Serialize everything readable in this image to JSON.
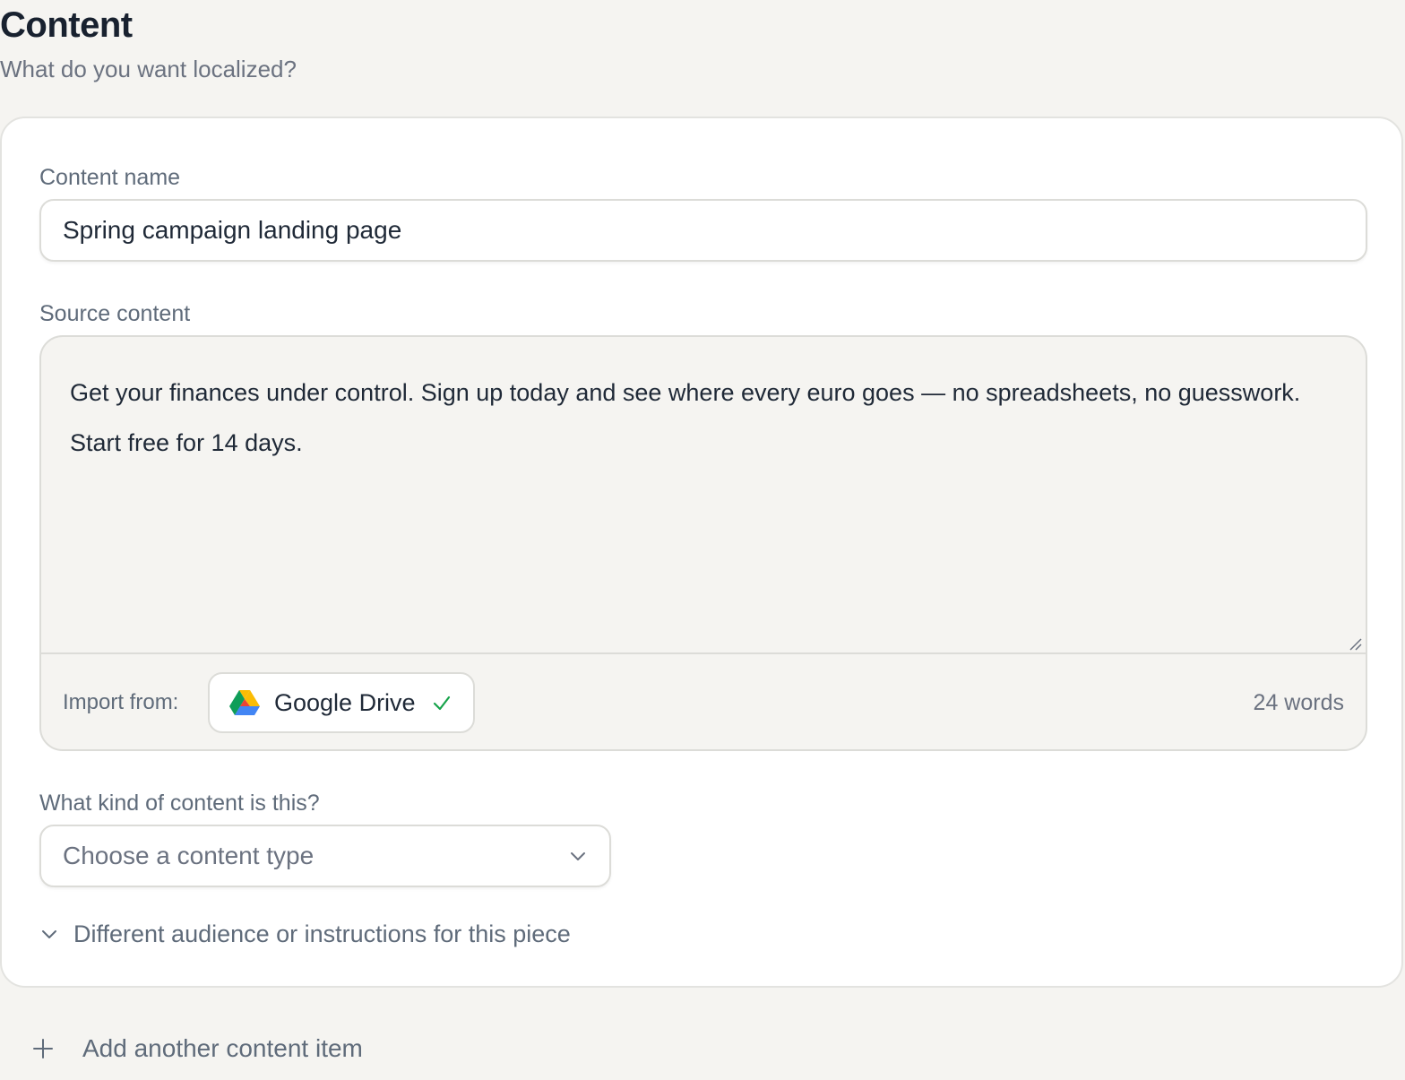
{
  "section": {
    "title": "Content",
    "subtitle": "What do you want localized?"
  },
  "content_name": {
    "label": "Content name",
    "value": "Spring campaign landing page"
  },
  "source_content": {
    "label": "Source content",
    "text": "Get your finances under control. Sign up today and see where every euro goes — no spreadsheets, no guesswork. Start free for 14 days.",
    "import_label": "Import from:",
    "import_source": "Google Drive",
    "import_icon": "google-drive-icon",
    "import_status_icon": "check-icon",
    "word_count": "24 words"
  },
  "content_type": {
    "label": "What kind of content is this?",
    "placeholder": "Choose a content type",
    "icon": "chevron-down-icon"
  },
  "audience_toggle": {
    "label": "Different audience or instructions for this piece",
    "icon": "chevron-down-icon"
  },
  "add_item": {
    "label": "Add another content item",
    "icon": "plus-icon"
  },
  "colors": {
    "background": "#f5f4f1",
    "card": "#ffffff",
    "border": "#dcdcd8",
    "title": "#18212f",
    "muted": "#5f6b7a",
    "check": "#16a34a"
  }
}
